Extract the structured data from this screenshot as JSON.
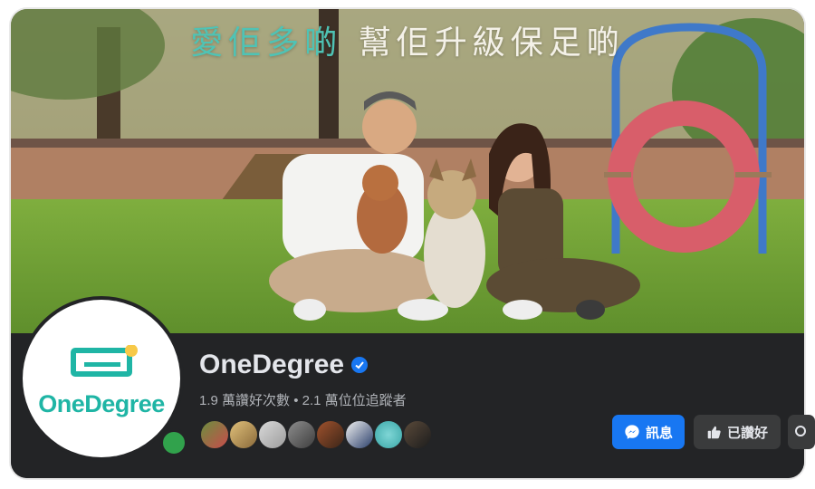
{
  "cover": {
    "headline_part1": "愛佢多啲",
    "headline_part2": "幫佢升級保足啲"
  },
  "avatar": {
    "brand_text": "OneDegree",
    "brand_color": "#1fb5a5",
    "logo_accent": "#f7c948",
    "online": true
  },
  "page": {
    "name": "OneDegree",
    "verified": true,
    "stats": "1.9 萬讚好次數 • 2.1 萬位位追蹤者"
  },
  "friends": {
    "count_shown": 8
  },
  "actions": {
    "message_label": "訊息",
    "message_icon": "messenger-icon",
    "liked_label": "已讚好",
    "liked_icon": "thumbs-up-icon",
    "more_icon": "search-icon"
  },
  "colors": {
    "accent_blue": "#1877f2",
    "bar_bg": "#232426",
    "text_primary": "#e4e6eb",
    "text_secondary": "#b0b3b8"
  }
}
